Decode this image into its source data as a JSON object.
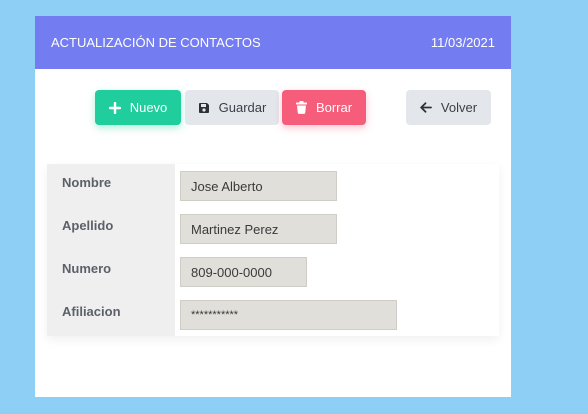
{
  "header": {
    "title": "ACTUALIZACIÓN DE CONTACTOS",
    "date": "11/03/2021"
  },
  "toolbar": {
    "nuevo_label": "Nuevo",
    "guardar_label": "Guardar",
    "borrar_label": "Borrar",
    "volver_label": "Volver"
  },
  "form": {
    "fields": [
      {
        "label": "Nombre",
        "value": "Jose Alberto"
      },
      {
        "label": "Apellido",
        "value": "Martinez Perez"
      },
      {
        "label": "Numero",
        "value": "809-000-0000"
      },
      {
        "label": "Afiliacion",
        "value": "***********"
      }
    ]
  },
  "colors": {
    "header": "#737cf0",
    "nuevo": "#1fce9c",
    "borrar": "#f55d7a",
    "neutral_button": "#e3e7ec",
    "background": "#8ecff5"
  },
  "icons": {
    "nuevo": "plus-icon",
    "guardar": "save-icon",
    "borrar": "trash-icon",
    "volver": "arrow-left-icon"
  }
}
